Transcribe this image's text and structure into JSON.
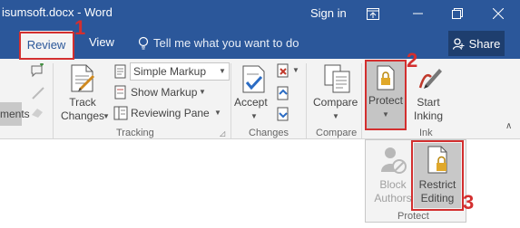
{
  "title": {
    "document": "isumsoft.docx - Word",
    "signin": "Sign in"
  },
  "tabs": {
    "review": "Review",
    "view": "View",
    "tellme": "Tell me what you want to do",
    "share": "Share"
  },
  "ribbon": {
    "left_partial_label": "ments",
    "track_changes": [
      "Track",
      "Changes"
    ],
    "markup_select": "Simple Markup",
    "show_markup": "Show Markup",
    "reviewing_pane": "Reviewing Pane",
    "accept": "Accept",
    "compare": "Compare",
    "protect": "Protect",
    "start_inking": [
      "Start",
      "Inking"
    ],
    "groups": {
      "tracking": "Tracking",
      "changes": "Changes",
      "compare": "Compare",
      "ink": "Ink"
    }
  },
  "popup": {
    "block_authors": [
      "Block",
      "Authors"
    ],
    "restrict_editing": [
      "Restrict",
      "Editing"
    ],
    "group": "Protect"
  },
  "annotations": {
    "step1": "1",
    "step2": "2",
    "step3": "3"
  },
  "colors": {
    "word_blue": "#2b579a",
    "annotation_red": "#d32f2f"
  }
}
